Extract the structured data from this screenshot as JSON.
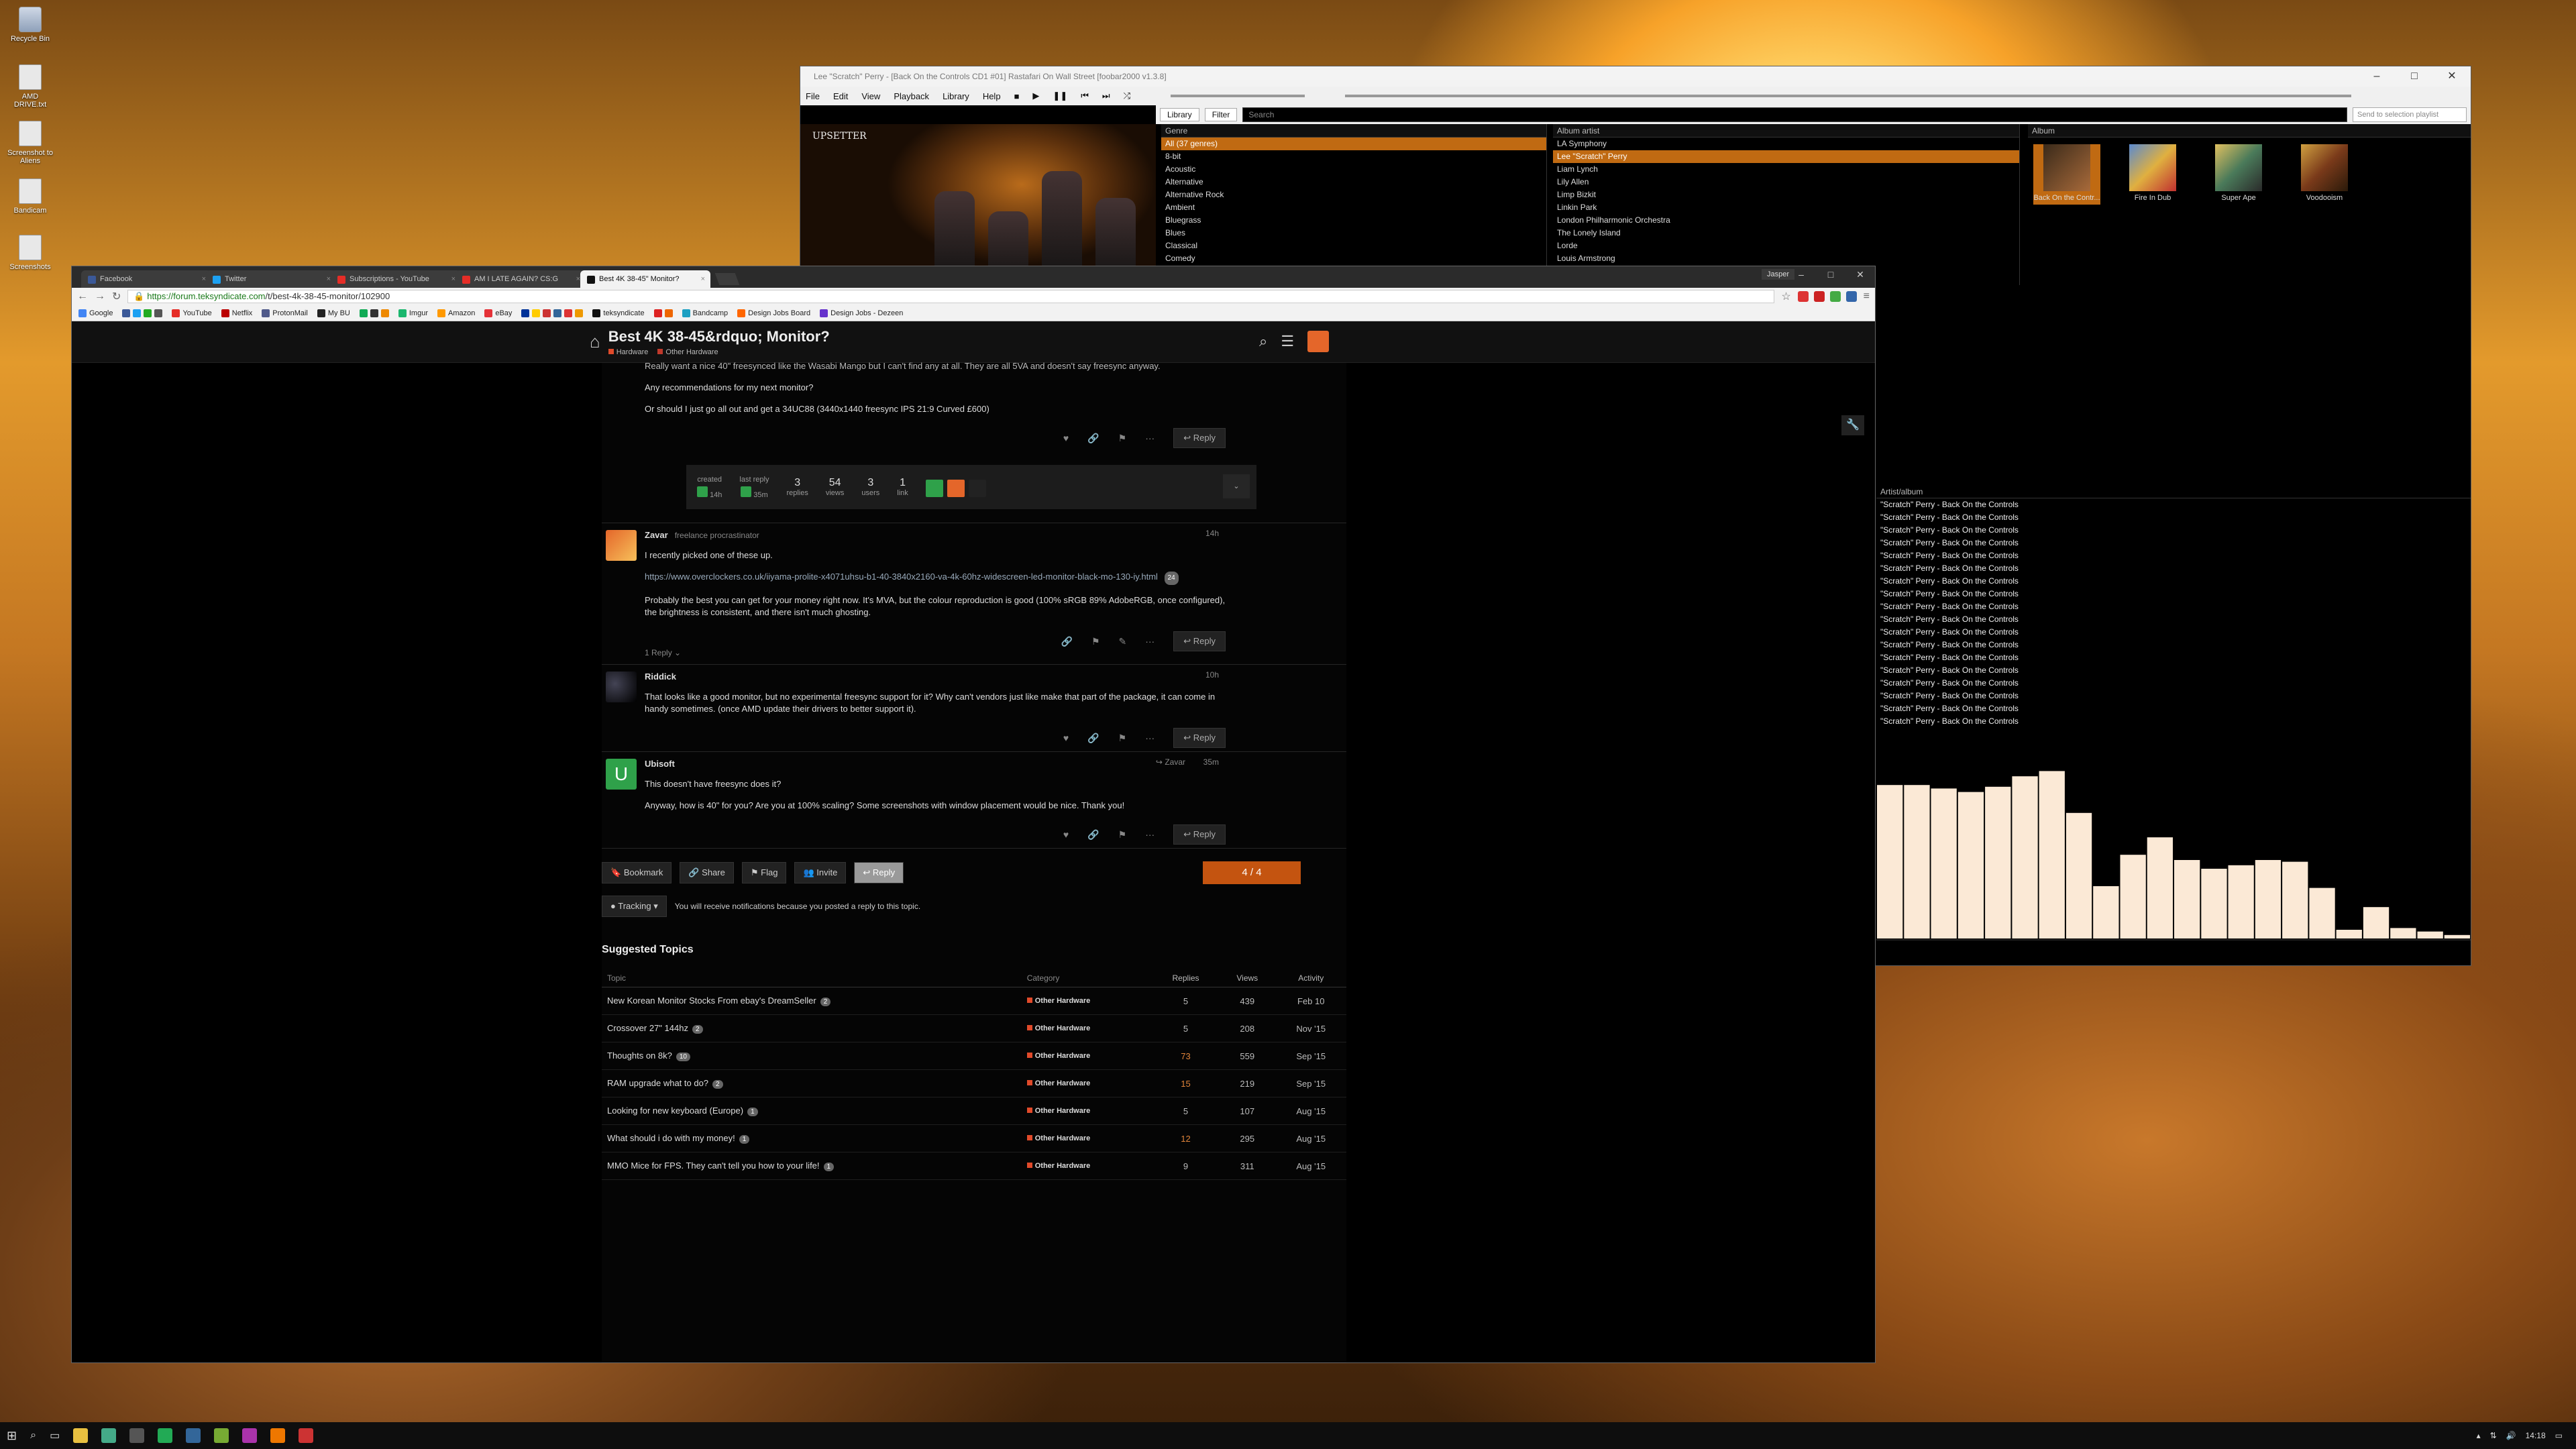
{
  "desktop": {
    "icons": [
      {
        "label": "Recycle Bin"
      },
      {
        "label": "AMD DRIVE.txt"
      },
      {
        "label": "Screenshot to Aliens"
      },
      {
        "label": "Bandicam"
      },
      {
        "label": "Screenshots"
      }
    ]
  },
  "foobar": {
    "title": "Lee \"Scratch\" Perry - [Back On the Controls CD1 #01] Rastafari On Wall Street   [foobar2000 v1.3.8]",
    "menu": [
      "File",
      "Edit",
      "View",
      "Playback",
      "Library",
      "Help"
    ],
    "library_select": "Library",
    "filter_select": "Filter",
    "search_placeholder": "Search",
    "send_to_playlist": "Send to selection playlist",
    "art_text": "UPSETTER",
    "genre": {
      "header": "Genre",
      "rows": [
        "All (37 genres)",
        "8-bit",
        "Acoustic",
        "Alternative",
        "Alternative Rock",
        "Ambient",
        "Bluegrass",
        "Blues",
        "Classical",
        "Comedy"
      ]
    },
    "album_artist": {
      "header": "Album artist",
      "rows": [
        "LA Symphony",
        "Lee \"Scratch\" Perry",
        "Liam Lynch",
        "Lily Allen",
        "Limp Bizkit",
        "Linkin Park",
        "London Philharmonic Orchestra",
        "The Lonely Island",
        "Lorde",
        "Louis Armstrong"
      ]
    },
    "album": {
      "header": "Album",
      "items": [
        "Back On the Contr...",
        "Fire In Dub",
        "Super Ape",
        "Voodooism"
      ]
    },
    "playlist": {
      "header": "Artist/album",
      "row_text": "\"Scratch\" Perry - Back On the Controls",
      "rows": 18
    },
    "spectrum": [
      0.88,
      0.88,
      0.86,
      0.84,
      0.87,
      0.93,
      0.96,
      0.72,
      0.3,
      0.48,
      0.58,
      0.45,
      0.4,
      0.42,
      0.45,
      0.44,
      0.29,
      0.05,
      0.18,
      0.06,
      0.04,
      0.02
    ]
  },
  "chrome": {
    "tabs": [
      {
        "label": "Facebook",
        "color": "#3b5998"
      },
      {
        "label": "Twitter",
        "color": "#1da1f2"
      },
      {
        "label": "Subscriptions - YouTube",
        "color": "#e52d27"
      },
      {
        "label": "AM I LATE AGAIN? CS:G",
        "color": "#e52d27"
      },
      {
        "label": "Best 4K 38-45\" Monitor?",
        "color": "#111111"
      }
    ],
    "profile": "Jasper",
    "url_scheme": "https://forum.teksyndicate.com",
    "url_path": "/t/best-4k-38-45-monitor/102900",
    "bookmarks": [
      "Google",
      "YouTube",
      "Netflix",
      "ProtonMail",
      "My BU",
      "Imgur",
      "Amazon",
      "eBay",
      "teksyndicate",
      "Bandcamp",
      "Design Jobs Board",
      "Design Jobs - Dezeen"
    ]
  },
  "topic": {
    "title": "Best 4K 38-45&rdquo; Monitor?",
    "categories": [
      "Hardware",
      "Other Hardware"
    ],
    "first_post": {
      "lines": [
        "Really want a nice 40\" freesynced like the Wasabi Mango but I can't find any at all. They are all 5VA and doesn't say freesync anyway.",
        "Any recommendations for my next monitor?",
        "Or should I just go all out and get a 34UC88 (3440x1440 freesync IPS 21:9 Curved £600)"
      ]
    },
    "topic_map": {
      "created_label": "created",
      "created_time": "14h",
      "last_reply_label": "last reply",
      "last_reply_time": "35m",
      "replies": "3",
      "replies_label": "replies",
      "views": "54",
      "views_label": "views",
      "users": "3",
      "users_label": "users",
      "link": "1",
      "link_label": "link"
    },
    "posts": [
      {
        "name": "Zavar",
        "title": "freelance procrastinator",
        "time": "14h",
        "p1": "I recently picked one of these up.",
        "link": "https://www.overclockers.co.uk/iiyama-prolite-x4071uhsu-b1-40-3840x2160-va-4k-60hz-widescreen-led-monitor-black-mo-130-iy.html",
        "link_clicks": "24",
        "p2": "Probably the best you can get for your money right now. It's MVA, but the colour reproduction is good (100% sRGB 89% AdobeRGB, once configured), the brightness is consistent, and there isn't much ghosting.",
        "replies_toggle": "1 Reply",
        "reply": "Reply"
      },
      {
        "name": "Riddick",
        "time": "10h",
        "p1": "That looks like a good monitor, but no experimental freesync support for it? Why can't vendors just like make that part of the package, it can come in handy sometimes. (once AMD update their drivers to better support it).",
        "reply": "Reply"
      },
      {
        "name": "Ubisoft",
        "in_reply_to": "Zavar",
        "time": "35m",
        "p1": "This doesn't have freesync does it?",
        "p2": "Anyway, how is 40\" for you? Are you at 100% scaling? Some screenshots with window placement would be nice. Thank you!",
        "reply": "Reply"
      }
    ],
    "footer": {
      "bookmark": "Bookmark",
      "share": "Share",
      "flag": "Flag",
      "invite": "Invite",
      "reply": "Reply",
      "progress": "4 / 4",
      "tracking": "Tracking",
      "tracking_text": "You will receive notifications because you posted a reply to this topic."
    },
    "suggested": {
      "title": "Suggested Topics",
      "headers": [
        "Topic",
        "Category",
        "Replies",
        "Views",
        "Activity"
      ],
      "rows": [
        {
          "topic": "New Korean Monitor Stocks From ebay's DreamSeller",
          "badge": "2",
          "category": "Other Hardware",
          "replies": "5",
          "views": "439",
          "activity": "Feb 10"
        },
        {
          "topic": "Crossover 27\" 144hz",
          "badge": "2",
          "category": "Other Hardware",
          "replies": "5",
          "views": "208",
          "activity": "Nov '15"
        },
        {
          "topic": "Thoughts on 8k?",
          "badge": "10",
          "category": "Other Hardware",
          "replies": "73",
          "views": "559",
          "activity": "Sep '15"
        },
        {
          "topic": "RAM upgrade what to do?",
          "badge": "2",
          "category": "Other Hardware",
          "replies": "15",
          "views": "219",
          "activity": "Sep '15"
        },
        {
          "topic": "Looking for new keyboard (Europe)",
          "badge": "1",
          "category": "Other Hardware",
          "replies": "5",
          "views": "107",
          "activity": "Aug '15"
        },
        {
          "topic": "What should i do with my money!",
          "badge": "1",
          "category": "Other Hardware",
          "replies": "12",
          "views": "295",
          "activity": "Aug '15"
        },
        {
          "topic": "MMO Mice for FPS. They can't tell you how to your life!",
          "badge": "1",
          "category": "Other Hardware",
          "replies": "9",
          "views": "311",
          "activity": "Aug '15"
        }
      ]
    }
  },
  "taskbar": {
    "time": "14:18"
  }
}
